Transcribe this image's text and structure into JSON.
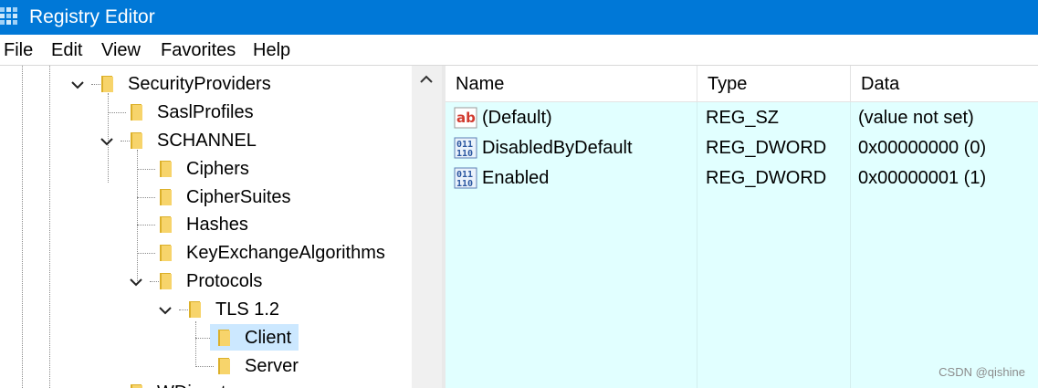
{
  "window": {
    "title": "Registry Editor"
  },
  "menu": {
    "items": [
      "File",
      "Edit",
      "View",
      "Favorites",
      "Help"
    ]
  },
  "tree": {
    "nodes": [
      {
        "label": "SecurityProviders",
        "expanded": true
      },
      {
        "label": "SaslProfiles"
      },
      {
        "label": "SCHANNEL",
        "expanded": true
      },
      {
        "label": "Ciphers"
      },
      {
        "label": "CipherSuites"
      },
      {
        "label": "Hashes"
      },
      {
        "label": "KeyExchangeAlgorithms"
      },
      {
        "label": "Protocols",
        "expanded": true
      },
      {
        "label": "TLS 1.2",
        "expanded": true
      },
      {
        "label": "Client",
        "selected": true
      },
      {
        "label": "Server"
      },
      {
        "label": "WDigest"
      }
    ]
  },
  "values": {
    "columns": {
      "name": "Name",
      "type": "Type",
      "data": "Data"
    },
    "rows": [
      {
        "name": "(Default)",
        "type": "REG_SZ",
        "data": "(value not set)",
        "icon": "string-value-icon"
      },
      {
        "name": "DisabledByDefault",
        "type": "REG_DWORD",
        "data": "0x00000000 (0)",
        "icon": "binary-value-icon"
      },
      {
        "name": "Enabled",
        "type": "REG_DWORD",
        "data": "0x00000001 (1)",
        "icon": "binary-value-icon"
      }
    ]
  },
  "watermark": "CSDN @qishine",
  "colors": {
    "titlebar": "#0078d7",
    "values_background": "#e1ffff",
    "selection": "#cce8ff"
  }
}
